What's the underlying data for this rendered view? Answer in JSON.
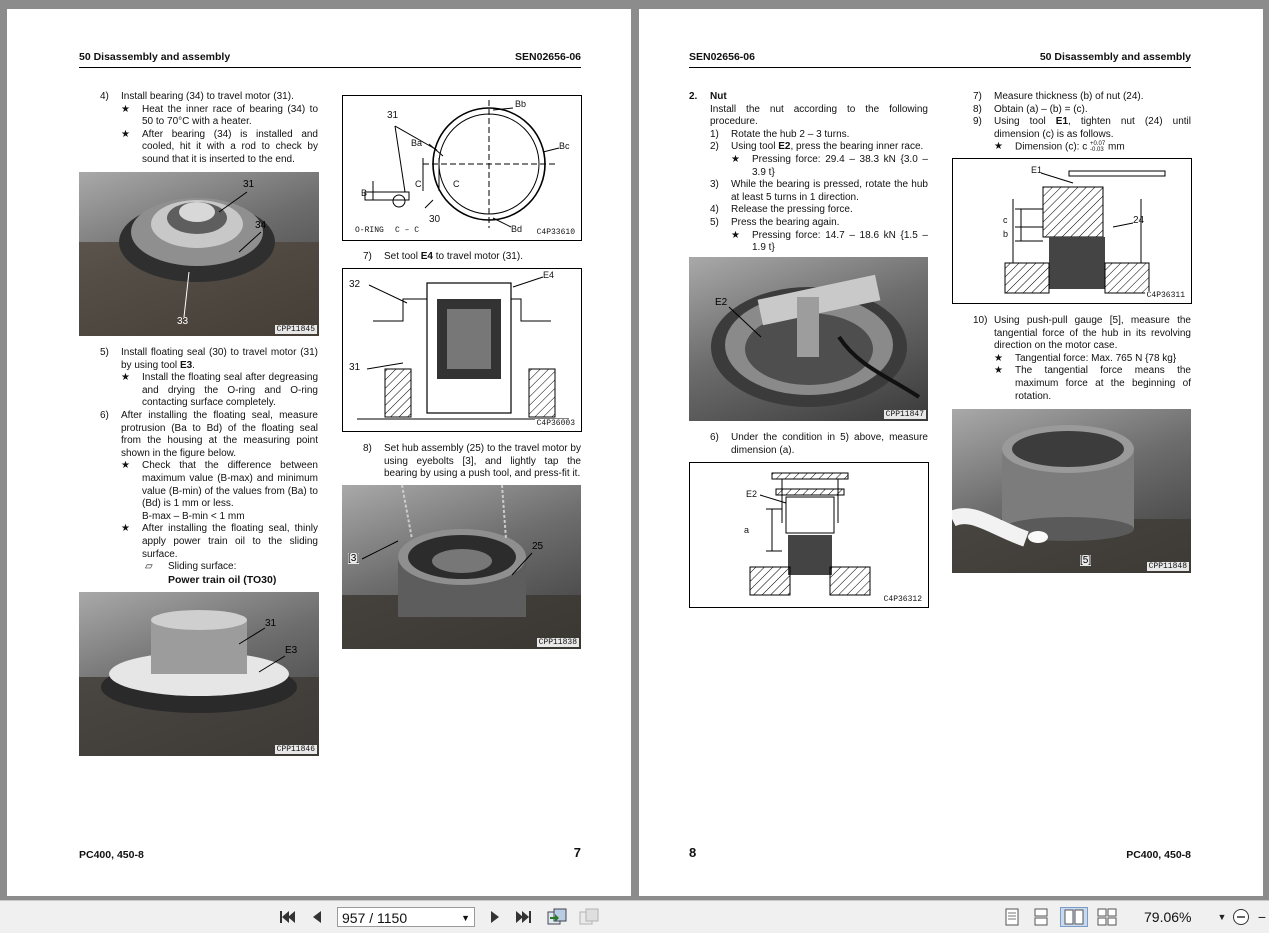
{
  "left": {
    "header_left": "50 Disassembly and assembly",
    "header_right": "SEN02656-06",
    "footer_left": "PC400, 450-8",
    "page_number": "7",
    "s4": {
      "num": "4)",
      "text": "Install bearing (34) to travel motor (31).",
      "star1": "Heat the inner race of bearing (34) to 50 to 70°C with a heater.",
      "star2": "After bearing (34) is installed and cooled, hit it with a rod to check by sound that it is inserted to the end."
    },
    "photo1": {
      "code": "CPP11845",
      "l1": "31",
      "l2": "34",
      "l3": "33"
    },
    "s5": {
      "num": "5)",
      "text_a": "Install floating seal (30) to travel motor (31) by using tool ",
      "tool": "E3",
      "text_b": ".",
      "star1": "Install the floating seal after degreasing and drying the O-ring and O-ring contacting surface completely."
    },
    "s6": {
      "num": "6)",
      "text": "After installing the floating seal, measure protrusion (Ba to Bd) of the floating seal from the housing at the measuring point shown in the figure below.",
      "star1": "Check that the difference between maximum value (B-max) and minimum value (B-min) of the values from (Ba) to (Bd) is 1 mm or less.",
      "formula": "B-max – B-min < 1 mm",
      "star2": "After installing the floating seal, thinly apply power train oil to the sliding surface.",
      "sliding": "Sliding surface:",
      "oil": "Power train oil (TO30)"
    },
    "photo2": {
      "code": "CPP11846",
      "l1": "31",
      "l2": "E3"
    },
    "fig1": {
      "code": "C4P33610",
      "l31": "31",
      "lBb": "Bb",
      "lBa": "Ba",
      "lBc": "Bc",
      "lB": "B",
      "lC1": "C",
      "lC2": "C",
      "l30": "30",
      "lBd": "Bd",
      "loring": "O-RING",
      "lcc": "C – C"
    },
    "s7": {
      "num": "7)",
      "text_a": "Set tool ",
      "tool": "E4",
      "text_b": " to travel motor (31)."
    },
    "fig2": {
      "code": "C4P36003",
      "l32": "32",
      "lE4": "E4",
      "l31": "31"
    },
    "s8": {
      "num": "8)",
      "text": "Set hub assembly (25) to the travel motor by using eyebolts [3], and lightly tap the bearing by using a push tool, and press-fit it."
    },
    "photo3": {
      "code": "CPP11838",
      "l1": "[3]",
      "l2": "25"
    }
  },
  "right": {
    "header_left": "SEN02656-06",
    "header_right": "50 Disassembly and assembly",
    "footer_right": "PC400, 450-8",
    "page_number": "8",
    "s2": {
      "num": "2.",
      "title": "Nut",
      "text": "Install the nut according to the following procedure.",
      "i1_num": "1)",
      "i1": "Rotate the hub 2 – 3 turns.",
      "i2_num": "2)",
      "i2_a": "Using tool ",
      "i2_tool": "E2",
      "i2_b": ", press the bearing inner race.",
      "i2_star": "Pressing force: 29.4 – 38.3 kN {3.0 – 3.9 t}",
      "i3_num": "3)",
      "i3": "While the bearing is pressed, rotate the hub at least 5 turns in 1 direction.",
      "i4_num": "4)",
      "i4": "Release the pressing force.",
      "i5_num": "5)",
      "i5": "Press the bearing again.",
      "i5_star": "Pressing force: 14.7 – 18.6 kN {1.5 – 1.9 t}"
    },
    "photo4": {
      "code": "CPP11847",
      "l1": "E2"
    },
    "s6": {
      "num": "6)",
      "text": "Under the condition in 5) above, measure dimension (a)."
    },
    "fig3": {
      "code": "C4P36312",
      "lE2": "E2",
      "la": "a"
    },
    "s7": {
      "num": "7)",
      "text": "Measure thickness (b) of nut (24)."
    },
    "s8": {
      "num": "8)",
      "text": "Obtain (a) – (b) = (c)."
    },
    "s9": {
      "num": "9)",
      "text_a": "Using tool ",
      "tool": "E1",
      "text_b": ", tighten nut (24) until dimension (c) is as follows.",
      "star": "Dimension (c): c",
      "tol_up": "+0.07",
      "tol_dn": "-0.03",
      "unit": "mm"
    },
    "fig4": {
      "code": "C4P36311",
      "lE1": "E1",
      "l24": "24",
      "lc": "c",
      "lb": "b"
    },
    "s10": {
      "num": "10)",
      "text": "Using push-pull gauge [5], measure the tangential force of the hub in its revolving direction on the motor case.",
      "star1": "Tangential force: Max. 765 N {78 kg}",
      "star2": "The tangential force means the maximum force at the beginning of rotation."
    },
    "photo5": {
      "code": "CPP11848",
      "l1": "[5]"
    }
  },
  "toolbar": {
    "first_icon": "skip-first-icon",
    "prev_icon": "prev-page-icon",
    "page_value": "957 / 1150",
    "next_icon": "next-page-icon",
    "last_icon": "skip-last-icon",
    "zoom": "79.06%",
    "zoom_out": "−"
  }
}
